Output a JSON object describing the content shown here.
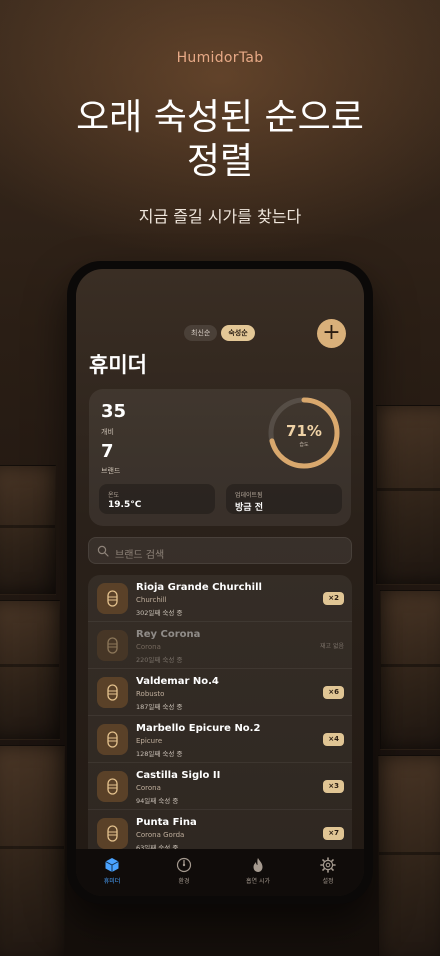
{
  "hero": {
    "brand": "HumidorTab",
    "headline_line1": "오래 숙성된 순으로",
    "headline_line2": "정렬",
    "subtitle": "지금 즐길 시가를 찾는다"
  },
  "app": {
    "sort": {
      "newest": "최신순",
      "aged": "숙성순",
      "active": "숙성순"
    },
    "add_label": "+",
    "title": "휴미더",
    "stats": {
      "count": "35",
      "count_label": "개비",
      "brands": "7",
      "brands_label": "브랜드",
      "humidity": "71%",
      "humidity_label": "습도",
      "humidity_fraction": 0.71,
      "temp_label": "온도",
      "temp_value": "19.5°C",
      "updated_label": "업데이트됨",
      "updated_value": "방금 전"
    },
    "search_placeholder": "브랜드 검색",
    "cigars": [
      {
        "name": "Rioja Grande Churchill",
        "vitola": "Churchill",
        "aged": "302일째 숙성 중",
        "qty": "×2",
        "soldout": ""
      },
      {
        "name": "Rey Corona",
        "vitola": "Corona",
        "aged": "220일째 숙성 중",
        "qty": "",
        "soldout": "재고 없음"
      },
      {
        "name": "Valdemar No.4",
        "vitola": "Robusto",
        "aged": "187일째 숙성 중",
        "qty": "×6",
        "soldout": ""
      },
      {
        "name": "Marbello Epicure No.2",
        "vitola": "Epicure",
        "aged": "128일째 숙성 중",
        "qty": "×4",
        "soldout": ""
      },
      {
        "name": "Castilla Siglo II",
        "vitola": "Corona",
        "aged": "94일째 숙성 중",
        "qty": "×3",
        "soldout": ""
      },
      {
        "name": "Punta Fina",
        "vitola": "Corona Gorda",
        "aged": "63일째 숙성 중",
        "qty": "×7",
        "soldout": ""
      }
    ],
    "tabs": [
      {
        "label": "휴미더",
        "icon": "box-icon"
      },
      {
        "label": "환경",
        "icon": "gauge-icon"
      },
      {
        "label": "흡연 시가",
        "icon": "flame-icon"
      },
      {
        "label": "설정",
        "icon": "gear-icon"
      }
    ],
    "colors": {
      "accent": "#d9b07a",
      "tab_active": "#4aa3ff"
    }
  }
}
